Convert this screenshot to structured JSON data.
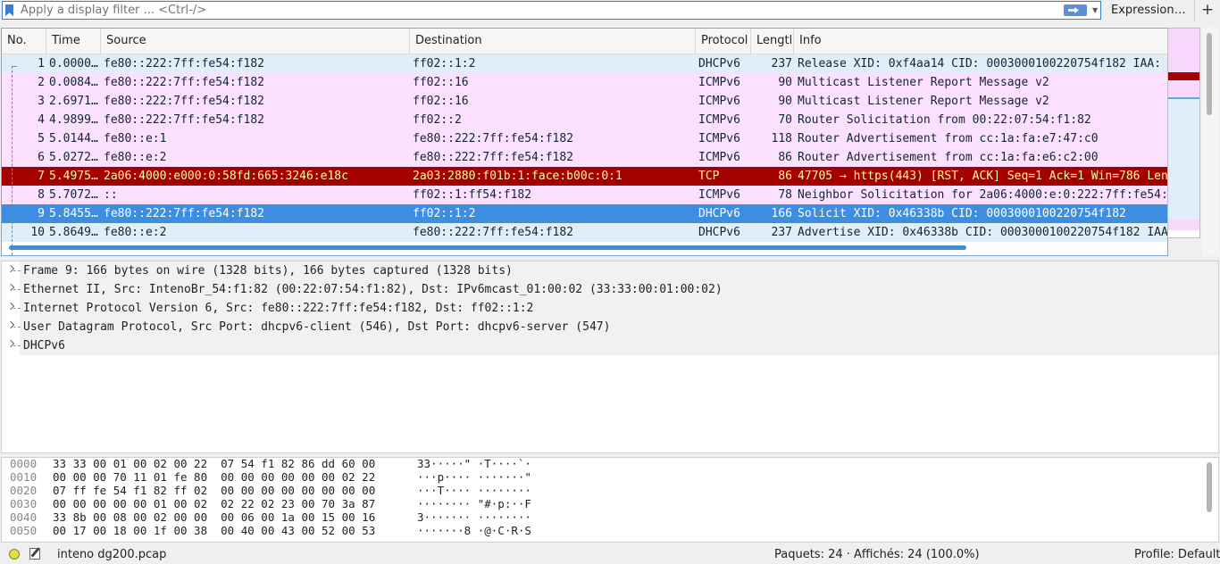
{
  "filter": {
    "placeholder": "Apply a display filter ... <Ctrl-/>",
    "expression_label": "Expression…",
    "add_label": "+"
  },
  "packet_list": {
    "columns": [
      "No.",
      "Time",
      "Source",
      "Destination",
      "Protocol",
      "Lengtl",
      "Info"
    ],
    "rows": [
      {
        "no": "1",
        "time": "0.0000…",
        "src": "fe80::222:7ff:fe54:f182",
        "dst": "ff02::1:2",
        "proto": "DHCPv6",
        "len": "237",
        "info": "Release XID: 0xf4aa14 CID: 0003000100220754f182 IAA:",
        "bg": "#e0eefa",
        "fg": "#12272e"
      },
      {
        "no": "2",
        "time": "0.0084…",
        "src": "fe80::222:7ff:fe54:f182",
        "dst": "ff02::16",
        "proto": "ICMPv6",
        "len": "90",
        "info": "Multicast Listener Report Message v2",
        "bg": "#fce0ff",
        "fg": "#12272e"
      },
      {
        "no": "3",
        "time": "2.6971…",
        "src": "fe80::222:7ff:fe54:f182",
        "dst": "ff02::16",
        "proto": "ICMPv6",
        "len": "90",
        "info": "Multicast Listener Report Message v2",
        "bg": "#fce0ff",
        "fg": "#12272e"
      },
      {
        "no": "4",
        "time": "4.9899…",
        "src": "fe80::222:7ff:fe54:f182",
        "dst": "ff02::2",
        "proto": "ICMPv6",
        "len": "70",
        "info": "Router Solicitation from 00:22:07:54:f1:82",
        "bg": "#fce0ff",
        "fg": "#12272e"
      },
      {
        "no": "5",
        "time": "5.0144…",
        "src": "fe80::e:1",
        "dst": "fe80::222:7ff:fe54:f182",
        "proto": "ICMPv6",
        "len": "118",
        "info": "Router Advertisement from cc:1a:fa:e7:47:c0",
        "bg": "#fce0ff",
        "fg": "#12272e"
      },
      {
        "no": "6",
        "time": "5.0272…",
        "src": "fe80::e:2",
        "dst": "fe80::222:7ff:fe54:f182",
        "proto": "ICMPv6",
        "len": "86",
        "info": "Router Advertisement from cc:1a:fa:e6:c2:00",
        "bg": "#fce0ff",
        "fg": "#12272e"
      },
      {
        "no": "7",
        "time": "5.4975…",
        "src": "2a06:4000:e000:0:58fd:665:3246:e18c",
        "dst": "2a03:2880:f01b:1:face:b00c:0:1",
        "proto": "TCP",
        "len": "86",
        "info": "47705 → https(443) [RST, ACK] Seq=1 Ack=1 Win=786 Len",
        "bg": "#a40000",
        "fg": "#fffc9c"
      },
      {
        "no": "8",
        "time": "5.7072…",
        "src": "::",
        "dst": "ff02::1:ff54:f182",
        "proto": "ICMPv6",
        "len": "78",
        "info": "Neighbor Solicitation for 2a06:4000:e:0:222:7ff:fe54:",
        "bg": "#fce0ff",
        "fg": "#12272e"
      },
      {
        "no": "9",
        "time": "5.8455…",
        "src": "fe80::222:7ff:fe54:f182",
        "dst": "ff02::1:2",
        "proto": "DHCPv6",
        "len": "166",
        "info": "Solicit XID: 0x46338b CID: 0003000100220754f182",
        "bg": "#3d8ee0",
        "fg": "#ffffff"
      },
      {
        "no": "10",
        "time": "5.8649…",
        "src": "fe80::e:2",
        "dst": "fe80::222:7ff:fe54:f182",
        "proto": "DHCPv6",
        "len": "237",
        "info": "Advertise XID: 0x46338b CID: 0003000100220754f182 IAA",
        "bg": "#e0eefa",
        "fg": "#12272e"
      }
    ]
  },
  "details": [
    "Frame 9: 166 bytes on wire (1328 bits), 166 bytes captured (1328 bits)",
    "Ethernet II, Src: IntenoBr_54:f1:82 (00:22:07:54:f1:82), Dst: IPv6mcast_01:00:02 (33:33:00:01:00:02)",
    "Internet Protocol Version 6, Src: fe80::222:7ff:fe54:f182, Dst: ff02::1:2",
    "User Datagram Protocol, Src Port: dhcpv6-client (546), Dst Port: dhcpv6-server (547)",
    "DHCPv6"
  ],
  "bytes": [
    {
      "offset": "0000",
      "hex": "33 33 00 01 00 02 00 22  07 54 f1 82 86 dd 60 00",
      "ascii": "33·····\" ·T····`·"
    },
    {
      "offset": "0010",
      "hex": "00 00 00 70 11 01 fe 80  00 00 00 00 00 00 02 22",
      "ascii": "···p···· ·······\""
    },
    {
      "offset": "0020",
      "hex": "07 ff fe 54 f1 82 ff 02  00 00 00 00 00 00 00 00",
      "ascii": "···T···· ········"
    },
    {
      "offset": "0030",
      "hex": "00 00 00 00 00 01 00 02  02 22 02 23 00 70 3a 87",
      "ascii": "········ \"#·p:··F"
    },
    {
      "offset": "0040",
      "hex": "33 8b 00 08 00 02 00 00  00 06 00 1a 00 15 00 16",
      "ascii": "3······· ········"
    },
    {
      "offset": "0050",
      "hex": "00 17 00 18 00 1f 00 38  00 40 00 43 00 52 00 53",
      "ascii": "·······8 ·@·C·R·S"
    }
  ],
  "status": {
    "file": "inteno dg200.pcap",
    "packets": "Paquets: 24 · Affichés: 24 (100.0%)",
    "profile": "Profile: Default"
  }
}
